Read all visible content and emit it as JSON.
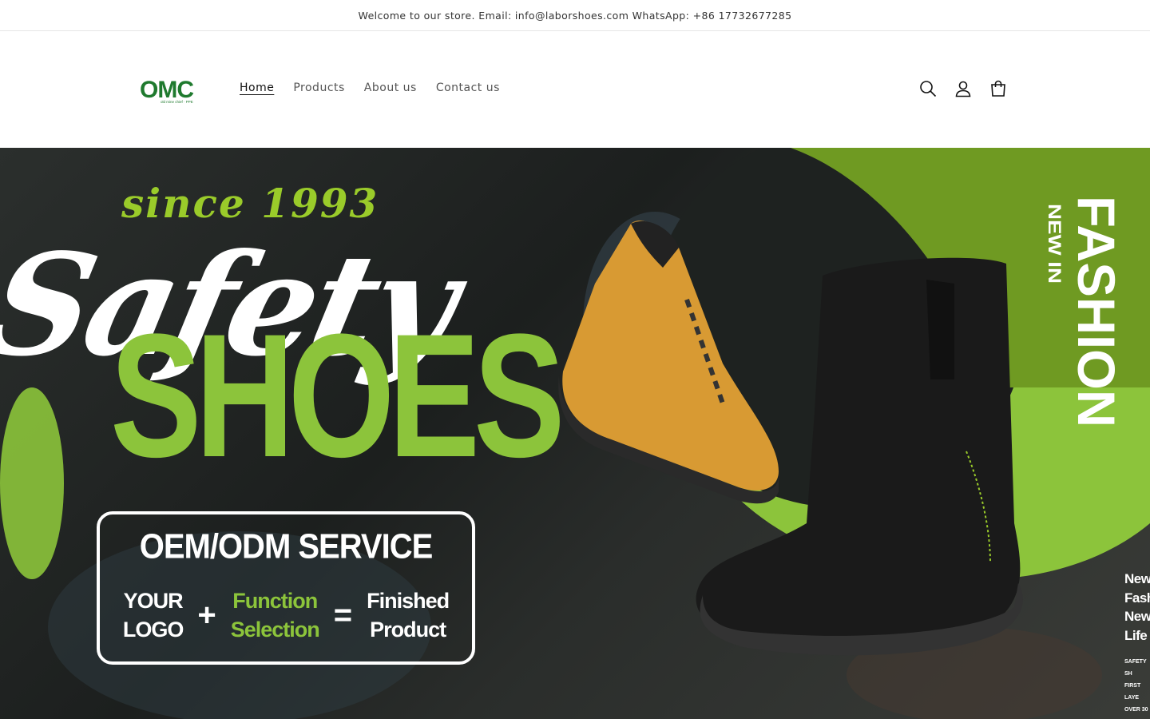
{
  "announcement": "Welcome to our store. Email: info@laborshoes.com WhatsApp: +86 17732677285",
  "logo": {
    "text": "OMC",
    "tagline": "old mine chief · PPE"
  },
  "nav": [
    {
      "label": "Home",
      "active": true
    },
    {
      "label": "Products",
      "active": false
    },
    {
      "label": "About us",
      "active": false
    },
    {
      "label": "Contact us",
      "active": false
    }
  ],
  "header_icons": [
    "search-icon",
    "account-icon",
    "cart-icon"
  ],
  "hero": {
    "since": "since 1993",
    "script": "Safety",
    "shoes": "SHOES",
    "oem_title": "OEM/ODM SERVICE",
    "oem_your_logo_1": "YOUR",
    "oem_your_logo_2": "LOGO",
    "oem_plus": "+",
    "oem_function_1": "Function",
    "oem_function_2": "Selection",
    "oem_equals": "=",
    "oem_finished_1": "Finished",
    "oem_finished_2": "Product",
    "fashion": "FASHION",
    "new_in": "NEW IN",
    "side_lines": [
      "New",
      "Fash",
      "New",
      "Life"
    ],
    "side_small": [
      "SAFETY SH",
      "FIRST LAYE",
      "OVER 30 YE"
    ]
  },
  "colors": {
    "accent_green": "#8cc43b",
    "text": "#121212"
  }
}
